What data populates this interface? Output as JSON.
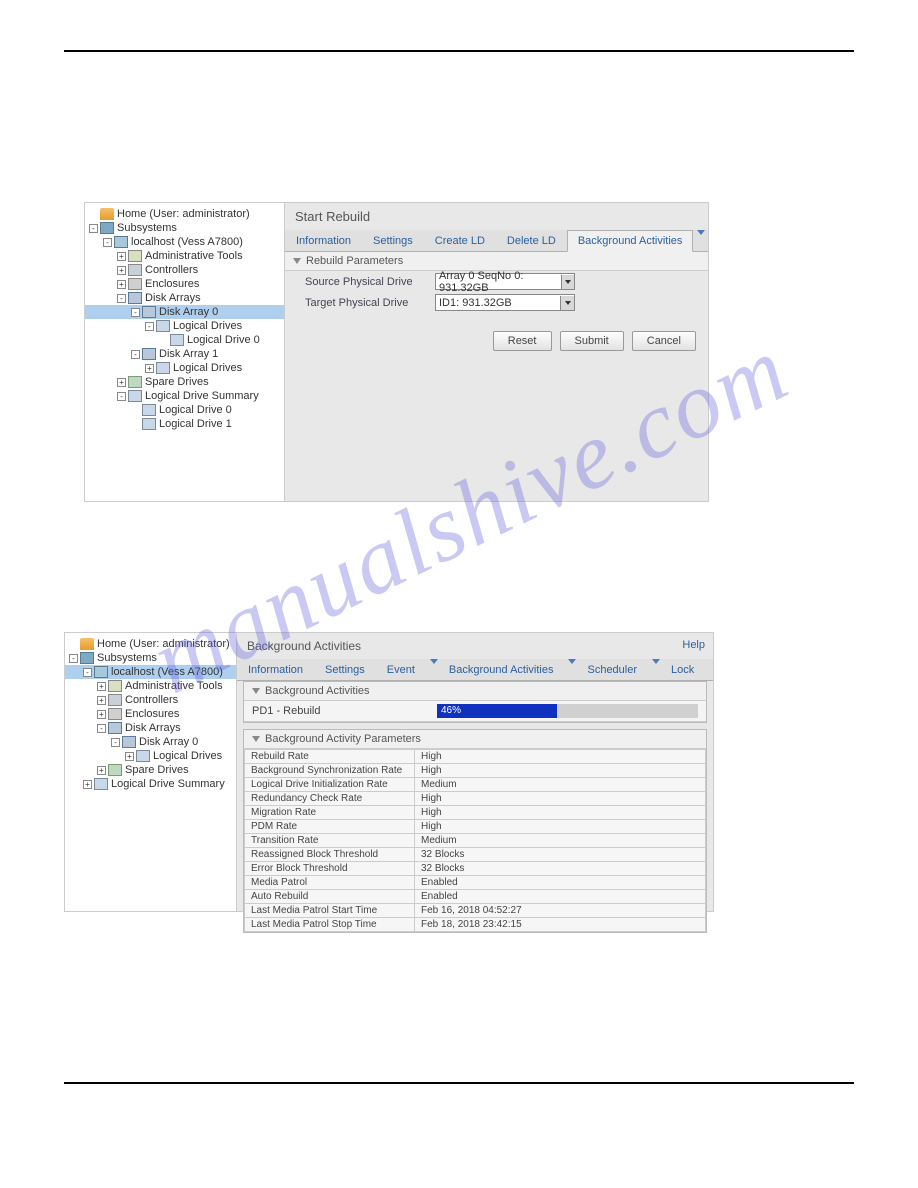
{
  "watermark": "manualshive.com",
  "panel1": {
    "tree": [
      {
        "indent": 0,
        "exp": "",
        "icon": "ic-home",
        "label": "Home (User: administrator)",
        "sel": false
      },
      {
        "indent": 0,
        "exp": "-",
        "icon": "ic-sub",
        "label": "Subsystems",
        "sel": false
      },
      {
        "indent": 14,
        "exp": "-",
        "icon": "ic-host",
        "label": "localhost (Vess A7800)",
        "sel": false
      },
      {
        "indent": 28,
        "exp": "+",
        "icon": "ic-tool",
        "label": "Administrative Tools",
        "sel": false
      },
      {
        "indent": 28,
        "exp": "+",
        "icon": "ic-ctrl",
        "label": "Controllers",
        "sel": false
      },
      {
        "indent": 28,
        "exp": "+",
        "icon": "ic-enc",
        "label": "Enclosures",
        "sel": false
      },
      {
        "indent": 28,
        "exp": "-",
        "icon": "ic-da",
        "label": "Disk Arrays",
        "sel": false
      },
      {
        "indent": 42,
        "exp": "-",
        "icon": "ic-da",
        "label": "Disk Array 0",
        "sel": true
      },
      {
        "indent": 56,
        "exp": "-",
        "icon": "ic-ld",
        "label": "Logical Drives",
        "sel": false
      },
      {
        "indent": 70,
        "exp": "",
        "icon": "ic-ld",
        "label": "Logical Drive 0",
        "sel": false
      },
      {
        "indent": 42,
        "exp": "-",
        "icon": "ic-da",
        "label": "Disk Array 1",
        "sel": false
      },
      {
        "indent": 56,
        "exp": "+",
        "icon": "ic-ld",
        "label": "Logical Drives",
        "sel": false
      },
      {
        "indent": 28,
        "exp": "+",
        "icon": "ic-spare",
        "label": "Spare Drives",
        "sel": false
      },
      {
        "indent": 28,
        "exp": "-",
        "icon": "ic-ld",
        "label": "Logical Drive Summary",
        "sel": false
      },
      {
        "indent": 42,
        "exp": "",
        "icon": "ic-ld",
        "label": "Logical Drive 0",
        "sel": false
      },
      {
        "indent": 42,
        "exp": "",
        "icon": "ic-ld",
        "label": "Logical Drive 1",
        "sel": false
      }
    ],
    "title": "Start Rebuild",
    "tabs": [
      {
        "label": "Information",
        "active": false,
        "dd": false
      },
      {
        "label": "Settings",
        "active": false,
        "dd": false
      },
      {
        "label": "Create LD",
        "active": false,
        "dd": false
      },
      {
        "label": "Delete LD",
        "active": false,
        "dd": false
      },
      {
        "label": "Background Activities",
        "active": true,
        "dd": true
      }
    ],
    "section": "Rebuild Parameters",
    "fields": {
      "source_label": "Source Physical Drive",
      "source_value": "Array 0 SeqNo 0: 931.32GB",
      "target_label": "Target Physical Drive",
      "target_value": "ID1: 931.32GB"
    },
    "buttons": {
      "reset": "Reset",
      "submit": "Submit",
      "cancel": "Cancel"
    }
  },
  "panel2": {
    "tree": [
      {
        "indent": 0,
        "exp": "",
        "icon": "ic-home",
        "label": "Home (User: administrator)",
        "sel": false
      },
      {
        "indent": 0,
        "exp": "-",
        "icon": "ic-sub",
        "label": "Subsystems",
        "sel": false
      },
      {
        "indent": 14,
        "exp": "-",
        "icon": "ic-host",
        "label": "localhost (Vess A7800)",
        "sel": true
      },
      {
        "indent": 28,
        "exp": "+",
        "icon": "ic-tool",
        "label": "Administrative Tools",
        "sel": false
      },
      {
        "indent": 28,
        "exp": "+",
        "icon": "ic-ctrl",
        "label": "Controllers",
        "sel": false
      },
      {
        "indent": 28,
        "exp": "+",
        "icon": "ic-enc",
        "label": "Enclosures",
        "sel": false
      },
      {
        "indent": 28,
        "exp": "-",
        "icon": "ic-da",
        "label": "Disk Arrays",
        "sel": false
      },
      {
        "indent": 42,
        "exp": "-",
        "icon": "ic-da",
        "label": "Disk Array 0",
        "sel": false
      },
      {
        "indent": 56,
        "exp": "+",
        "icon": "ic-ld",
        "label": "Logical Drives",
        "sel": false
      },
      {
        "indent": 28,
        "exp": "+",
        "icon": "ic-spare",
        "label": "Spare Drives",
        "sel": false
      },
      {
        "indent": 14,
        "exp": "+",
        "icon": "ic-ld",
        "label": "Logical Drive Summary",
        "sel": false
      }
    ],
    "title": "Background Activities",
    "help": "Help",
    "tabs": [
      {
        "label": "Information",
        "active": false,
        "dd": false
      },
      {
        "label": "Settings",
        "active": false,
        "dd": false
      },
      {
        "label": "Event",
        "active": false,
        "dd": true
      },
      {
        "label": "Background Activities",
        "active": false,
        "dd": true
      },
      {
        "label": "Scheduler",
        "active": false,
        "dd": true
      },
      {
        "label": "Lock",
        "active": false,
        "dd": false
      }
    ],
    "section1": "Background Activities",
    "progress": {
      "label": "PD1 - Rebuild",
      "pct_text": "46%",
      "pct": 46
    },
    "section2": "Background Activity Parameters",
    "params": [
      {
        "k": "Rebuild Rate",
        "v": "High"
      },
      {
        "k": "Background Synchronization Rate",
        "v": "High"
      },
      {
        "k": "Logical Drive Initialization Rate",
        "v": "Medium"
      },
      {
        "k": "Redundancy Check Rate",
        "v": "High"
      },
      {
        "k": "Migration Rate",
        "v": "High"
      },
      {
        "k": "PDM Rate",
        "v": "High"
      },
      {
        "k": "Transition Rate",
        "v": "Medium"
      },
      {
        "k": "Reassigned Block Threshold",
        "v": "32 Blocks"
      },
      {
        "k": "Error Block Threshold",
        "v": "32 Blocks"
      },
      {
        "k": "Media Patrol",
        "v": "Enabled"
      },
      {
        "k": "Auto Rebuild",
        "v": "Enabled"
      },
      {
        "k": "Last Media Patrol Start Time",
        "v": "Feb 16, 2018 04:52:27"
      },
      {
        "k": "Last Media Patrol Stop Time",
        "v": "Feb 18, 2018 23:42:15"
      }
    ]
  }
}
